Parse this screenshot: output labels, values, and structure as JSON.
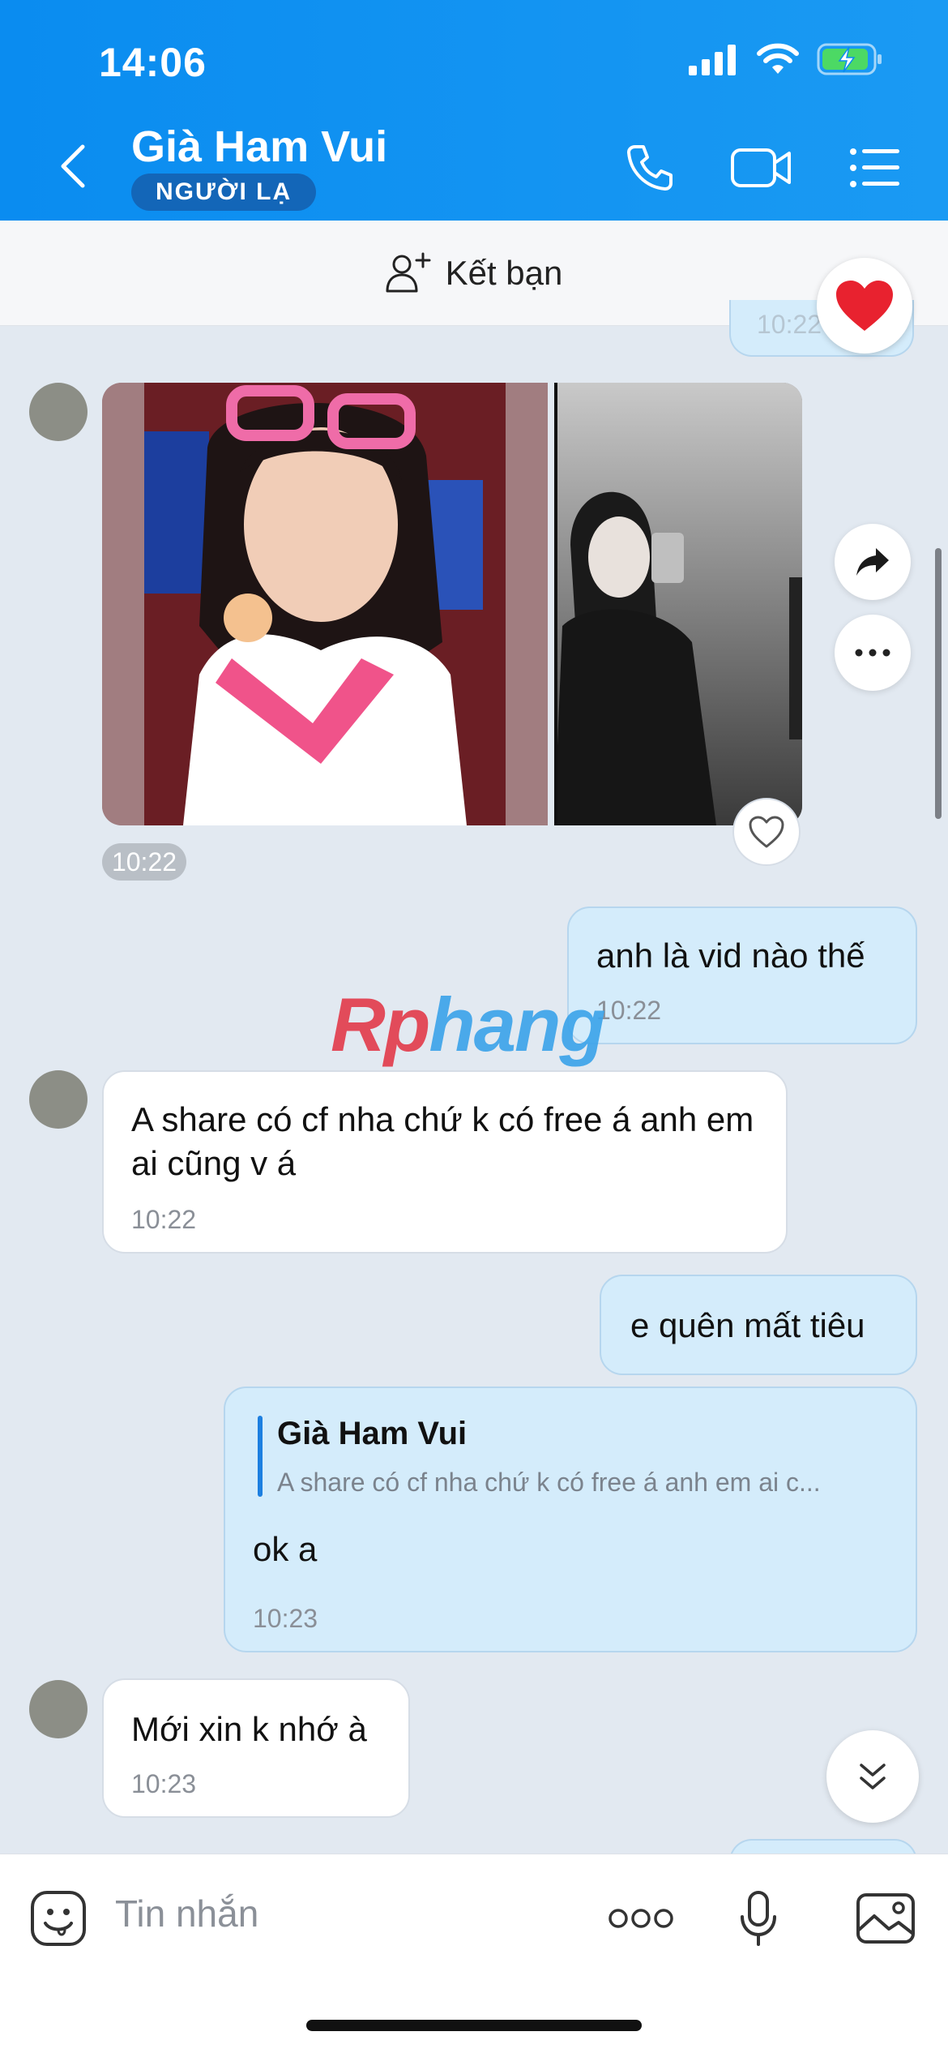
{
  "status_bar": {
    "time": "14:06"
  },
  "header": {
    "contact_name": "Già Ham Vui",
    "contact_badge": "NGƯỜI LẠ"
  },
  "friend_bar": {
    "label": "Kết bạn"
  },
  "messages": {
    "photo_time": "10:22",
    "out1": {
      "text": "anh là vid nào thế",
      "time": "10:22"
    },
    "in1": {
      "text": "A share có cf nha chứ k có free á anh em ai cũng v á",
      "time": "10:22"
    },
    "out2": {
      "text": "e quên mất tiêu"
    },
    "out3": {
      "quote_name": "Già Ham Vui",
      "quote_text": "A share có cf nha chứ k có free á anh em ai c...",
      "text": "ok a",
      "time": "10:23"
    },
    "in2": {
      "text": "Mới xin k nhớ à",
      "time": "10:23"
    },
    "partial_time": "10:22"
  },
  "watermark": {
    "part1": "Rp",
    "part2": "hang"
  },
  "input": {
    "placeholder": "Tin nhắn"
  },
  "colors": {
    "header_blue": "#0a8cf0",
    "out_bubble": "#d4ecfb",
    "badge": "#1366b8",
    "heart": "#e8222f"
  }
}
